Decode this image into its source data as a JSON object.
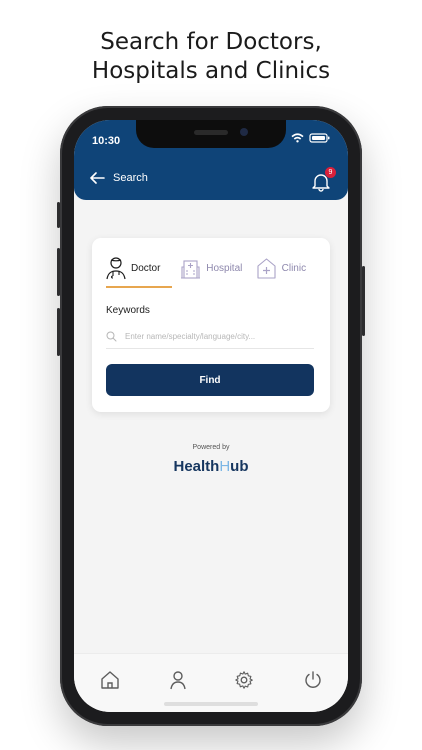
{
  "headline": {
    "line1": "Search for Doctors,",
    "line2": "Hospitals and Clinics"
  },
  "status_bar": {
    "time": "10:30"
  },
  "header": {
    "title": "Search",
    "notification_count": "9"
  },
  "search_card": {
    "tabs": [
      {
        "label": "Doctor",
        "icon": "doctor-icon",
        "active": true
      },
      {
        "label": "Hospital",
        "icon": "hospital-icon",
        "active": false
      },
      {
        "label": "Clinic",
        "icon": "clinic-icon",
        "active": false
      }
    ],
    "keywords_label": "Keywords",
    "search_placeholder": "Enter name/specialty/language/city...",
    "find_button": "Find"
  },
  "footer_brand": {
    "powered_by": "Powered by",
    "logo_text": "HealthHub"
  },
  "colors": {
    "header_blue": "#0f4478",
    "button_navy": "#12345f",
    "active_tab_underline": "#e7a64f",
    "notification_red": "#d8203a"
  },
  "bottom_nav": [
    {
      "name": "home",
      "icon": "home-icon"
    },
    {
      "name": "profile",
      "icon": "user-icon"
    },
    {
      "name": "settings",
      "icon": "gear-icon"
    },
    {
      "name": "power",
      "icon": "power-icon"
    }
  ]
}
